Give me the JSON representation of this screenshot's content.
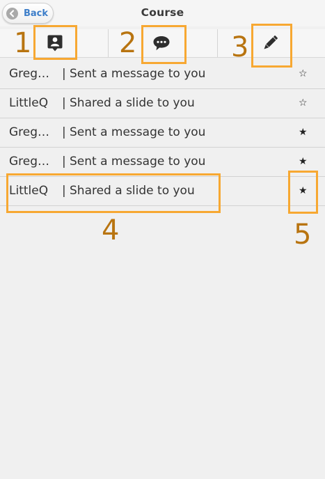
{
  "header": {
    "back_label": "Back",
    "title": "Course"
  },
  "tabs": [
    {
      "icon": "contact-card-icon"
    },
    {
      "icon": "chat-bubble-icon"
    },
    {
      "icon": "pencil-icon"
    }
  ],
  "notifications": [
    {
      "sender": "Greg…",
      "separator": "|",
      "message": "Sent a message to you",
      "star": "☆"
    },
    {
      "sender": "LittleQ",
      "separator": "|",
      "message": "Shared a slide to you",
      "star": "☆"
    },
    {
      "sender": "Greg…",
      "separator": "|",
      "message": "Sent a message to you",
      "star": "★"
    },
    {
      "sender": "Greg…",
      "separator": "|",
      "message": "Sent a message to you",
      "star": "★"
    },
    {
      "sender": "LittleQ",
      "separator": "|",
      "message": "Shared a slide to you",
      "star": "★"
    }
  ],
  "annotations": {
    "labels": [
      "1",
      "2",
      "3",
      "4",
      "5"
    ],
    "color": "#f7a832"
  }
}
